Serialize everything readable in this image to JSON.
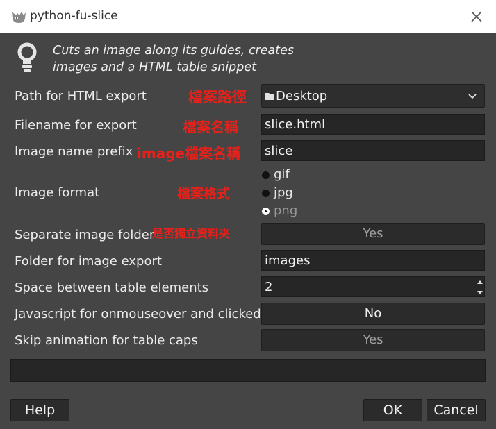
{
  "window": {
    "title": "python-fu-slice",
    "close_icon": "close-icon"
  },
  "description": {
    "line1": "Cuts an image along its guides, creates",
    "line2": "images and a HTML table snippet"
  },
  "fields": {
    "path": {
      "label": "Path for HTML export",
      "annotation": "檔案路徑",
      "value": "Desktop"
    },
    "filename": {
      "label": "Filename for export",
      "annotation": "檔案名稱",
      "value": "slice.html"
    },
    "prefix": {
      "label": "Image name prefix",
      "annotation": "image檔案名稱",
      "value": "slice"
    },
    "format": {
      "label": "Image format",
      "annotation": "檔案格式",
      "options": [
        "gif",
        "jpg",
        "png"
      ],
      "selected": "png"
    },
    "separate_folder": {
      "label": "Separate image folder",
      "annotation": "是否獨立資料夾",
      "value": "Yes"
    },
    "image_folder": {
      "label": "Folder for image export",
      "value": "images"
    },
    "space": {
      "label": "Space between table elements",
      "value": "2"
    },
    "javascript": {
      "label": "Javascript for onmouseover and clicked",
      "value": "No"
    },
    "skip_animation": {
      "label": "Skip animation for table caps",
      "value": "Yes"
    }
  },
  "buttons": {
    "help": "Help",
    "ok": "OK",
    "cancel": "Cancel"
  },
  "colors": {
    "background": "#454545",
    "annotation": "#e8201a",
    "field": "#262626"
  }
}
